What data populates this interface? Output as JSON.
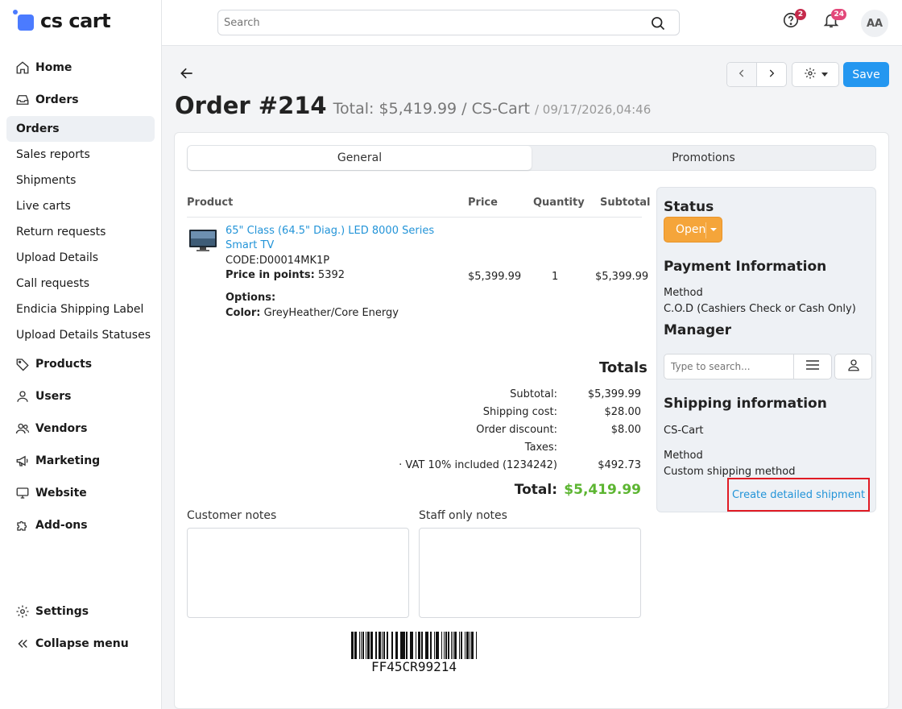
{
  "app": {
    "logo_text": "cs cart"
  },
  "sidebar": {
    "items": [
      {
        "label": "Home",
        "icon": "home-icon",
        "type": "top"
      },
      {
        "label": "Orders",
        "icon": "inbox-icon",
        "type": "top"
      },
      {
        "label": "Orders",
        "type": "sub",
        "active": true
      },
      {
        "label": "Sales reports",
        "type": "sub"
      },
      {
        "label": "Shipments",
        "type": "sub"
      },
      {
        "label": "Live carts",
        "type": "sub"
      },
      {
        "label": "Return requests",
        "type": "sub"
      },
      {
        "label": "Upload Details",
        "type": "sub"
      },
      {
        "label": "Call requests",
        "type": "sub"
      },
      {
        "label": "Endicia Shipping Label",
        "type": "sub"
      },
      {
        "label": "Upload Details Statuses",
        "type": "sub"
      },
      {
        "label": "Products",
        "icon": "tag-icon",
        "type": "top"
      },
      {
        "label": "Users",
        "icon": "user-icon",
        "type": "top"
      },
      {
        "label": "Vendors",
        "icon": "users-icon",
        "type": "top"
      },
      {
        "label": "Marketing",
        "icon": "megaphone-icon",
        "type": "top"
      },
      {
        "label": "Website",
        "icon": "monitor-icon",
        "type": "top"
      },
      {
        "label": "Add-ons",
        "icon": "puzzle-icon",
        "type": "top"
      }
    ],
    "settings_label": "Settings",
    "collapse_label": "Collapse menu"
  },
  "topbar": {
    "search_placeholder": "Search",
    "help_badge": "2",
    "notifications_badge": "24",
    "avatar_initials": "AA"
  },
  "toolbar": {
    "save_label": "Save"
  },
  "order": {
    "title": "Order #214",
    "total_summary": "Total: $5,419.99 / CS-Cart",
    "date": "/ 09/17/2026,04:46"
  },
  "tabs": [
    {
      "label": "General",
      "active": true
    },
    {
      "label": "Promotions",
      "active": false
    }
  ],
  "products_table": {
    "headers": {
      "product": "Product",
      "price": "Price",
      "quantity": "Quantity",
      "subtotal": "Subtotal"
    },
    "rows": [
      {
        "name": "65\" Class (64.5\" Diag.) LED 8000 Series Smart TV",
        "code": "CODE:D00014MK1P",
        "points_label": "Price in points:",
        "points_value": "5392",
        "options_label": "Options:",
        "color_label": "Color:",
        "color_value": "GreyHeather/Core Energy",
        "price": "$5,399.99",
        "quantity": "1",
        "subtotal": "$5,399.99"
      }
    ]
  },
  "totals": {
    "heading": "Totals",
    "lines": [
      {
        "label": "Subtotal:",
        "value": "$5,399.99"
      },
      {
        "label": "Shipping cost:",
        "value": "$28.00"
      },
      {
        "label": "Order discount:",
        "value": "$8.00"
      },
      {
        "label": "Taxes:",
        "value": ""
      },
      {
        "label": "· VAT 10% included (1234242)",
        "value": "$492.73"
      }
    ],
    "total_label": "Total:",
    "total_value": "$5,419.99",
    "total_color": "#5cb531"
  },
  "notes": {
    "customer_label": "Customer notes",
    "staff_label": "Staff only notes"
  },
  "barcode_text": "FF45CR99214",
  "right_panel": {
    "status_heading": "Status",
    "status_value": "Open",
    "status_color": "#f5a53a",
    "payment_heading": "Payment Information",
    "payment_method_label": "Method",
    "payment_method_value": "C.O.D (Cashiers Check or Cash Only)",
    "manager_heading": "Manager",
    "manager_placeholder": "Type to search...",
    "shipping_heading": "Shipping information",
    "shipping_carrier": "CS-Cart",
    "shipping_method_label": "Method",
    "shipping_method_value": "Custom shipping method",
    "create_shipment_label": "Create detailed shipment"
  }
}
